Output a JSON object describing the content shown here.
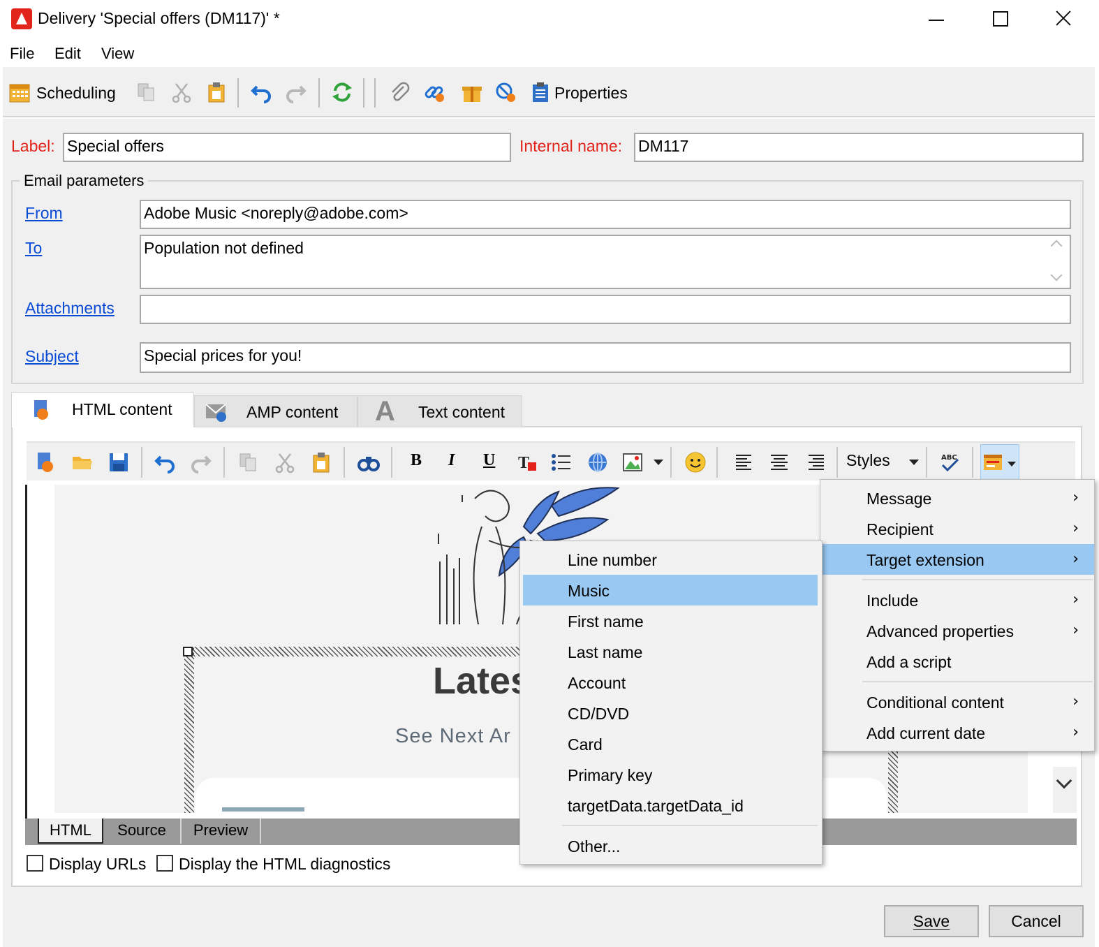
{
  "window": {
    "title": "Delivery 'Special offers (DM117)' *"
  },
  "menubar": [
    "File",
    "Edit",
    "View"
  ],
  "toolbar": {
    "scheduling_label": "Scheduling",
    "properties_label": "Properties"
  },
  "form": {
    "label_caption": "Label:",
    "label_value": "Special offers",
    "internal_name_caption": "Internal name:",
    "internal_name_value": "DM117"
  },
  "email_params": {
    "legend": "Email parameters",
    "from_link": "From",
    "from_value": "Adobe Music <noreply@adobe.com>",
    "to_link": "To",
    "to_value": "Population not defined",
    "attachments_link": "Attachments",
    "attachments_value": "",
    "subject_link": "Subject",
    "subject_value": "Special prices for you!"
  },
  "content_tabs": [
    {
      "label": "HTML content",
      "icon": "html-content-icon",
      "active": true
    },
    {
      "label": "AMP content",
      "icon": "amp-content-icon",
      "active": false
    },
    {
      "label": "Text content",
      "icon": "text-content-icon",
      "active": false
    }
  ],
  "editor_toolbar": {
    "styles_label": "Styles"
  },
  "email_preview": {
    "headline": "Lates",
    "subline": "See Next  Ar"
  },
  "editor_tabs": [
    "HTML",
    "Source",
    "Preview"
  ],
  "options": {
    "display_urls": "Display URLs",
    "display_diagnostics": "Display the HTML diagnostics"
  },
  "buttons": {
    "save": "Save",
    "cancel": "Cancel"
  },
  "context_menu": [
    {
      "label": "Message",
      "submenu": true
    },
    {
      "label": "Recipient",
      "submenu": true
    },
    {
      "label": "Target extension",
      "submenu": true,
      "highlighted": true
    },
    {
      "label": "Include",
      "submenu": true
    },
    {
      "label": "Advanced properties",
      "submenu": true
    },
    {
      "label": "Add a script",
      "submenu": false
    },
    {
      "label": "Conditional content",
      "submenu": true
    },
    {
      "label": "Add current date",
      "submenu": true
    }
  ],
  "target_extension_submenu": [
    {
      "label": "Line number"
    },
    {
      "label": "Music",
      "highlighted": true
    },
    {
      "label": "First name"
    },
    {
      "label": "Last name"
    },
    {
      "label": "Account"
    },
    {
      "label": "CD/DVD"
    },
    {
      "label": "Card"
    },
    {
      "label": "Primary key"
    },
    {
      "label": "targetData.targetData_id"
    },
    {
      "label": "Other..."
    }
  ],
  "colors": {
    "accent_red": "#e3231b",
    "link_blue": "#0a4bd6",
    "highlight": "#99c9f3"
  }
}
